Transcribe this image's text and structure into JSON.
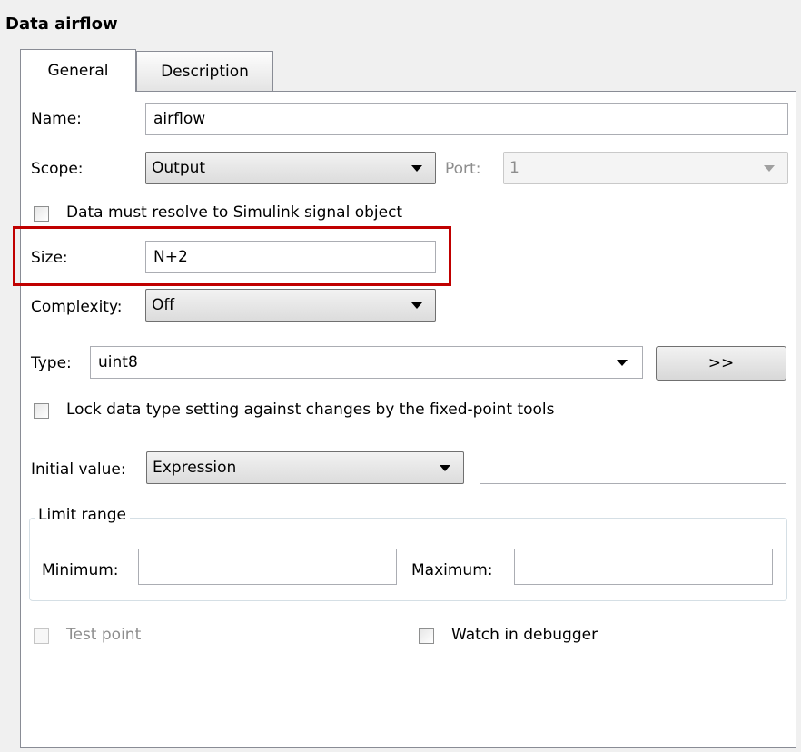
{
  "title": "Data airflow",
  "tabs": [
    {
      "label": "General",
      "active": true
    },
    {
      "label": "Description",
      "active": false
    }
  ],
  "fields": {
    "name_label": "Name:",
    "name_value": "airflow",
    "scope_label": "Scope:",
    "scope_value": "Output",
    "port_label": "Port:",
    "port_value": "1",
    "resolve_label": "Data must resolve to Simulink signal object",
    "resolve_checked": false,
    "size_label": "Size:",
    "size_value": "N+2",
    "complexity_label": "Complexity:",
    "complexity_value": "Off",
    "type_label": "Type:",
    "type_value": "uint8",
    "type_button_label": ">>",
    "lock_label": "Lock data type setting against changes by the fixed-point tools",
    "lock_checked": false,
    "initial_label": "Initial value:",
    "initial_mode": "Expression",
    "initial_value": "",
    "limit_range_title": "Limit range",
    "minimum_label": "Minimum:",
    "minimum_value": "",
    "maximum_label": "Maximum:",
    "maximum_value": "",
    "test_point_label": "Test point",
    "test_point_checked": false,
    "watch_label": "Watch in debugger",
    "watch_checked": false
  },
  "colors": {
    "highlight": "#c00000",
    "panel_background": "#ffffff",
    "window_background": "#f0f0f0"
  }
}
